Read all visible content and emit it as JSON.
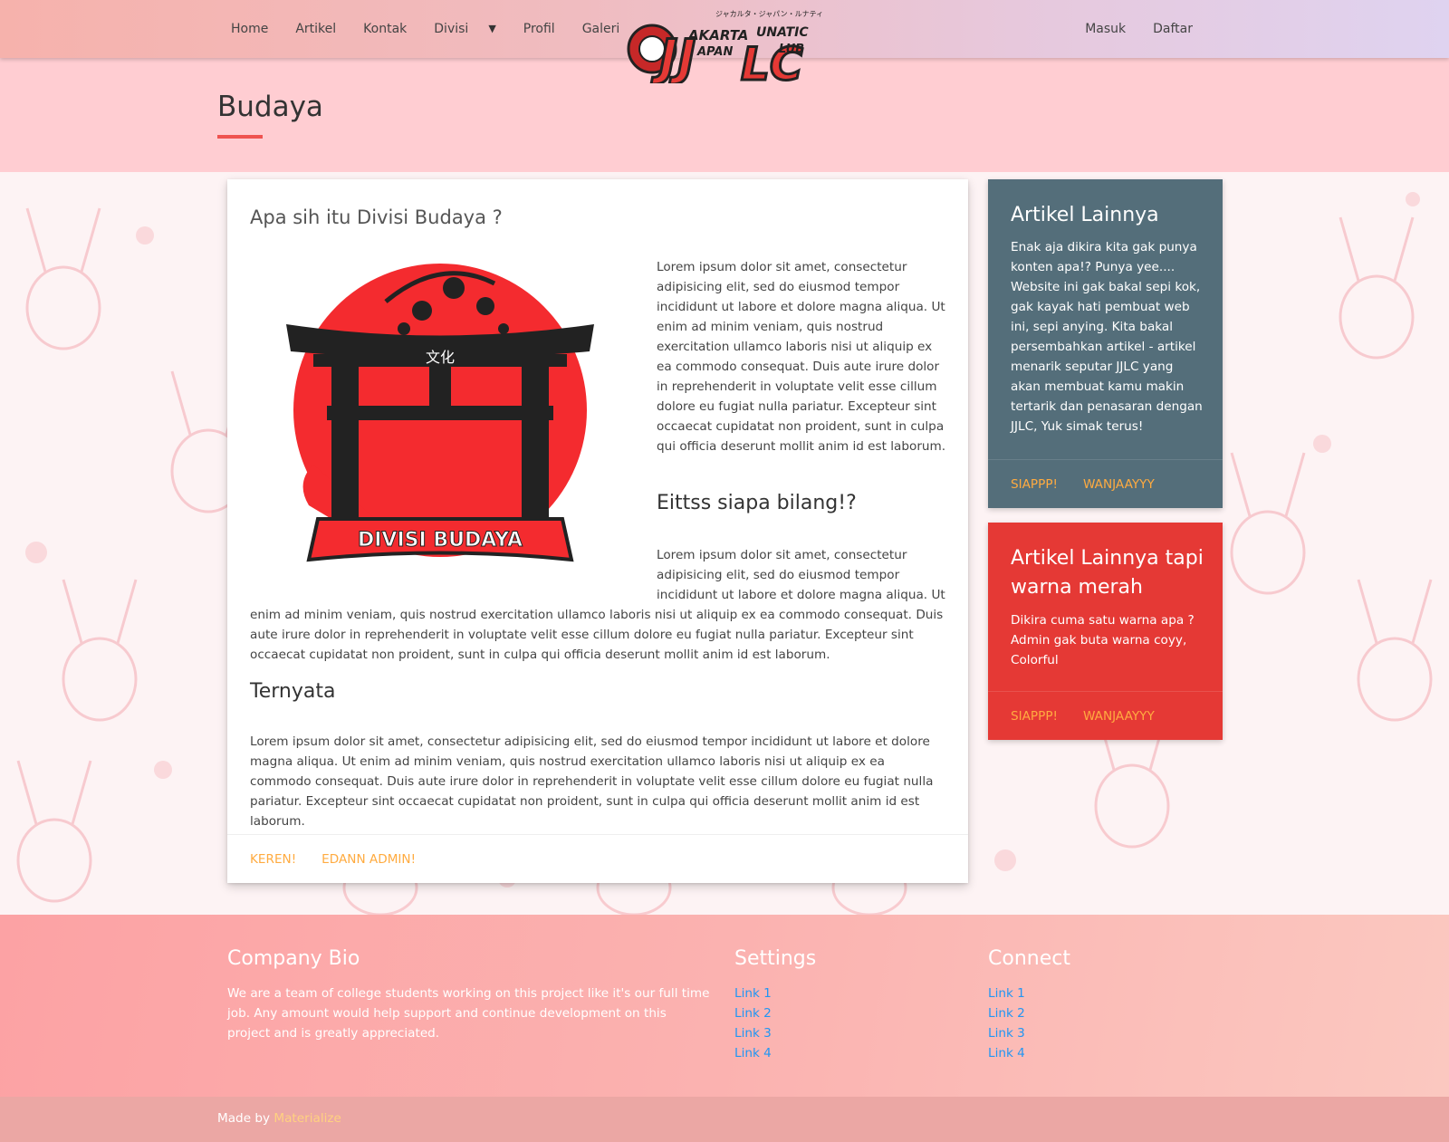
{
  "nav": {
    "left_items": [
      {
        "label": "Home"
      },
      {
        "label": "Artikel"
      },
      {
        "label": "Kontak"
      },
      {
        "label": "Divisi"
      },
      {
        "label": "Profil"
      },
      {
        "label": "Galeri"
      }
    ],
    "right_items": [
      {
        "label": "Masuk"
      },
      {
        "label": "Daftar"
      }
    ],
    "logo": {
      "top_text": "ジャカルタ・ジャパン・ルナティック・クラブ",
      "line1": "AKARTA",
      "line1b": "UNATIC",
      "line2": "APAN",
      "line2b": "LUB",
      "letters": "JJ",
      "letters2": "LC"
    }
  },
  "header": {
    "title": "Budaya"
  },
  "main_card": {
    "title": "Apa sih itu Divisi Budaya ?",
    "image": {
      "kanji": "文化",
      "banner": "DIVISI BUDAYA"
    },
    "para1": "Lorem ipsum dolor sit amet, consectetur adipisicing elit, sed do eiusmod tempor incididunt ut labore et dolore magna aliqua. Ut enim ad minim veniam, quis nostrud exercitation ullamco laboris nisi ut aliquip ex ea commodo consequat. Duis aute irure dolor in reprehenderit in voluptate velit esse cillum dolore eu fugiat nulla pariatur. Excepteur sint occaecat cupidatat non proident, sunt in culpa qui officia deserunt mollit anim id est laborum.",
    "subhead1": "Eittss siapa bilang!?",
    "para2a": "Lorem ipsum dolor sit amet, consectetur adipisicing elit, sed do eiusmod tempor incididunt ut labore et dolore magna aliqua. Ut",
    "para2b": "enim ad minim veniam, quis nostrud exercitation ullamco laboris nisi ut aliquip ex ea commodo consequat. Duis aute irure dolor in reprehenderit in voluptate velit esse cillum dolore eu fugiat nulla pariatur. Excepteur sint occaecat cupidatat non proident, sunt in culpa qui officia deserunt mollit anim id est laborum.",
    "subhead2": "Ternyata",
    "para3": "Lorem ipsum dolor sit amet, consectetur adipisicing elit, sed do eiusmod tempor incididunt ut labore et dolore magna aliqua. Ut enim ad minim veniam, quis nostrud exercitation ullamco laboris nisi ut aliquip ex ea commodo consequat. Duis aute irure dolor in reprehenderit in voluptate velit esse cillum dolore eu fugiat nulla pariatur. Excepteur sint occaecat cupidatat non proident, sunt in culpa qui officia deserunt mollit anim id est laborum.",
    "actions": [
      "KEREN!",
      "EDANN ADMIN!"
    ]
  },
  "side_cards": [
    {
      "title": "Artikel Lainnya",
      "body": "Enak aja dikira kita gak punya konten apa!? Punya yee.... Website ini gak bakal sepi kok, gak kayak hati pembuat web ini, sepi anying. Kita bakal persembahkan artikel - artikel menarik seputar JJLC yang akan membuat kamu makin tertarik dan penasaran dengan JJLC, Yuk simak terus!",
      "actions": [
        "SIAPPP!",
        "WANJAAYYY"
      ],
      "color": "#546e7a"
    },
    {
      "title": "Artikel Lainnya tapi warna merah",
      "body": "Dikira cuma satu warna apa ? Admin gak buta warna coyy, Colorful",
      "actions": [
        "SIAPPP!",
        "WANJAAYYY"
      ],
      "color": "#e53935"
    }
  ],
  "footer": {
    "bio_title": "Company Bio",
    "bio_text": "We are a team of college students working on this project like it's our full time job. Any amount would help support and continue development on this project and is greatly appreciated.",
    "settings_title": "Settings",
    "settings_links": [
      "Link 1",
      "Link 2",
      "Link 3",
      "Link 4"
    ],
    "connect_title": "Connect",
    "connect_links": [
      "Link 1",
      "Link 2",
      "Link 3",
      "Link 4"
    ],
    "made_by": "Made by",
    "made_by_link": "Materialize"
  },
  "colors": {
    "accent": "#ffab40",
    "title_underline": "#ef5350",
    "link": "#2196f3",
    "header_band": "#ffcdd2"
  }
}
